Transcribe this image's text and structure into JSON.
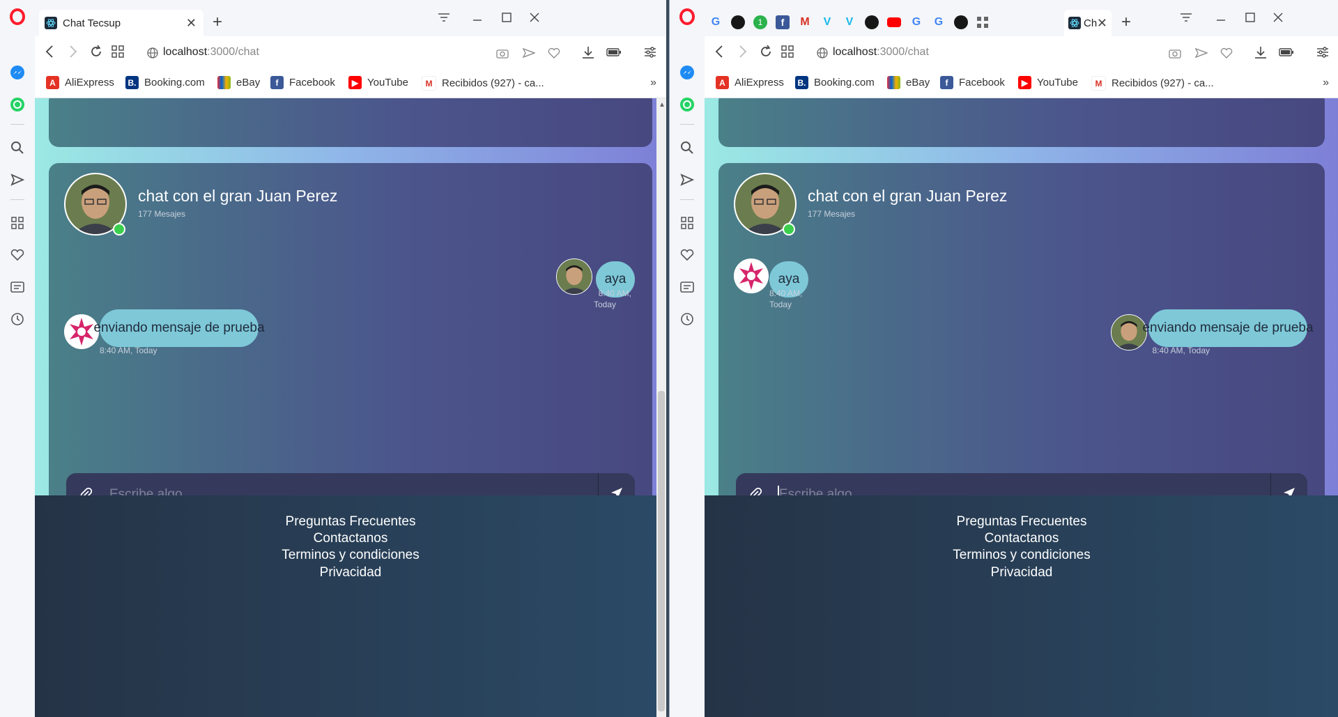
{
  "left": {
    "tab_title": "Chat Tecsup",
    "url_host": "localhost",
    "url_path": ":3000/chat",
    "bookmarks": [
      "AliExpress",
      "Booking.com",
      "eBay",
      "Facebook",
      "YouTube",
      "Recibidos (927) - ca..."
    ],
    "chat": {
      "title": "chat con el gran Juan Perez",
      "subtitle": "177 Mesajes",
      "messages": [
        {
          "text": "aya",
          "time": "8:40 AM,",
          "day": "Today",
          "side": "right"
        },
        {
          "text": "enviando mensaje de prueba",
          "time": "8:40 AM, Today",
          "side": "left"
        }
      ],
      "placeholder": "Escribe algo..."
    }
  },
  "right": {
    "tab_title": "Ch",
    "url_host": "localhost",
    "url_path": ":3000/chat",
    "bookmarks": [
      "AliExpress",
      "Booking.com",
      "eBay",
      "Facebook",
      "YouTube",
      "Recibidos (927) - ca..."
    ],
    "chat": {
      "title": "chat con el gran Juan Perez",
      "subtitle": "177 Mesajes",
      "messages": [
        {
          "text": "aya",
          "time": "8:40 AM,",
          "day": "Today",
          "side": "left"
        },
        {
          "text": "enviando mensaje de prueba",
          "time": "8:40 AM, Today",
          "side": "right"
        }
      ],
      "placeholder": "Escribe algo..."
    }
  },
  "footer": {
    "links": [
      "Preguntas Frecuentes",
      "Contactanos",
      "Terminos y condiciones",
      "Privacidad"
    ]
  },
  "colors": {
    "opera_red": "#ff1b2d",
    "bubble": "#7ec8d8",
    "online": "#3ccf4e"
  }
}
